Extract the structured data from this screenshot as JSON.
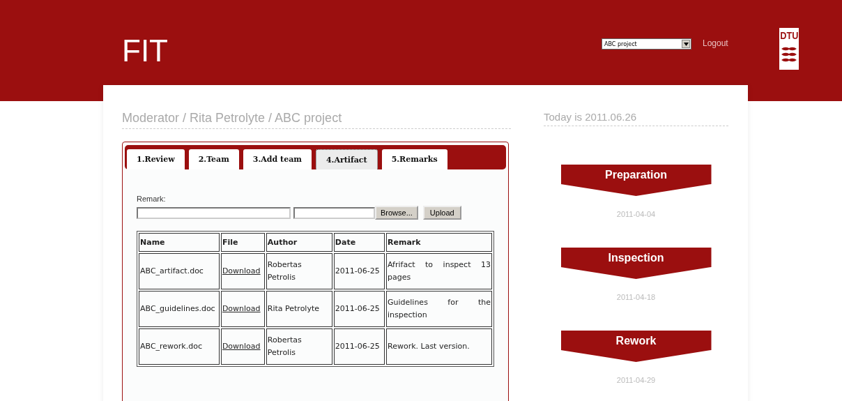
{
  "header": {
    "title": "FIT",
    "project_select": {
      "value": "ABC project"
    },
    "logout": "Logout",
    "logo": "DTU"
  },
  "breadcrumb": "Moderator / Rita Petrolyte / ABC project",
  "tabs": [
    {
      "label": "1.Review",
      "selected": false
    },
    {
      "label": "2.Team",
      "selected": false
    },
    {
      "label": "3.Add team",
      "selected": false
    },
    {
      "label": "4.Artifact",
      "selected": true
    },
    {
      "label": "5.Remarks",
      "selected": false
    }
  ],
  "upload_form": {
    "label": "Remark:",
    "browse": "Browse...",
    "upload": "Upload"
  },
  "table": {
    "columns": [
      "Name",
      "File",
      "Author",
      "Date",
      "Remark"
    ],
    "rows": [
      [
        "ABC_artifact.doc",
        "Download",
        "Robertas Petrolis",
        "2011-06-25",
        "Afrifact to inspect 13 pages"
      ],
      [
        "ABC_guidelines.doc",
        "Download",
        "Rita Petrolyte",
        "2011-06-25",
        "Guidelines for the inspection"
      ],
      [
        "ABC_rework.doc",
        "Download",
        "Robertas Petrolis",
        "2011-06-25",
        "Rework. Last version."
      ]
    ]
  },
  "today": "Today is 2011.06.26",
  "phases": [
    {
      "name": "Preparation",
      "date": "2011-04-04"
    },
    {
      "name": "Inspection",
      "date": "2011-04-18"
    },
    {
      "name": "Rework",
      "date": "2011-04-29"
    }
  ]
}
